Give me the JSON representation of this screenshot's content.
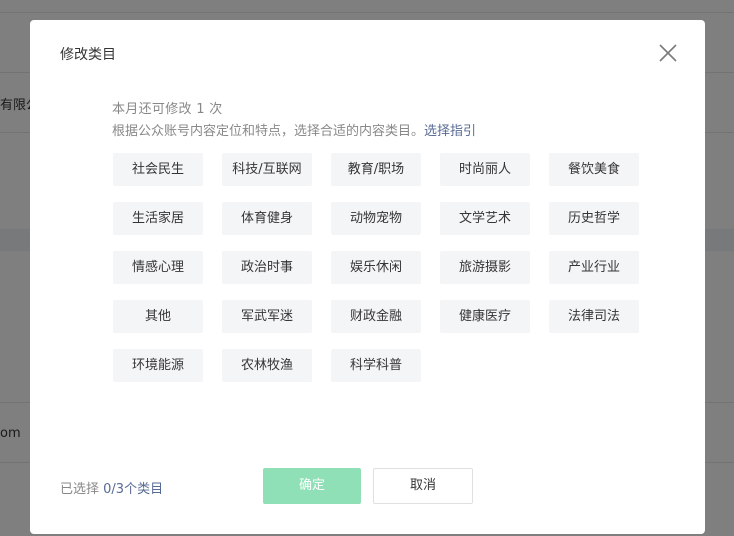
{
  "background": {
    "company_text": "有限公",
    "email_fragment": "om"
  },
  "dialog": {
    "title": "修改类目",
    "close_icon": "close-icon",
    "quota_text": "本月还可修改 1 次",
    "hint_text": "根据公众账号内容定位和特点，选择合适的内容类目。",
    "hint_link": "选择指引",
    "categories": [
      "社会民生",
      "科技/互联网",
      "教育/职场",
      "时尚丽人",
      "餐饮美食",
      "生活家居",
      "体育健身",
      "动物宠物",
      "文学艺术",
      "历史哲学",
      "情感心理",
      "政治时事",
      "娱乐休闲",
      "旅游摄影",
      "产业行业",
      "其他",
      "军武军迷",
      "财政金融",
      "健康医疗",
      "法律司法",
      "环境能源",
      "农林牧渔",
      "科学科普"
    ],
    "selected_label": "已选择 ",
    "selected_count": "0/3个类目",
    "confirm_label": "确定",
    "cancel_label": "取消",
    "colors": {
      "accent_link": "#576b95",
      "confirm_disabled": "#8fe0b6"
    }
  }
}
